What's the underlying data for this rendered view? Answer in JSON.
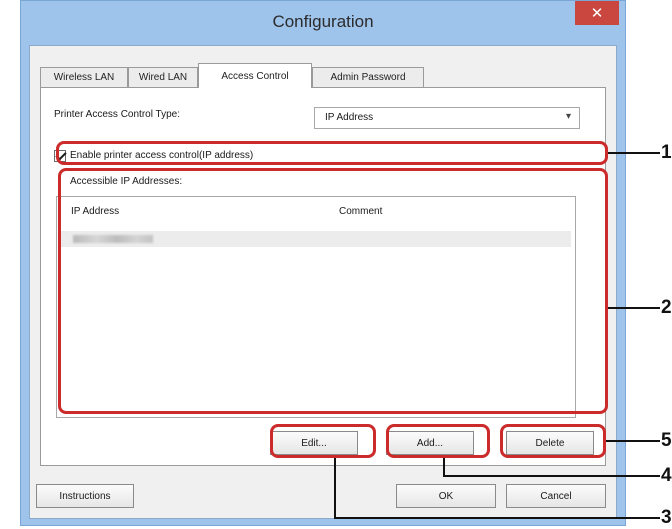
{
  "window": {
    "title": "Configuration",
    "close_glyph": "✕"
  },
  "tabs": [
    {
      "label": "Wireless LAN"
    },
    {
      "label": "Wired LAN"
    },
    {
      "label": "Access Control"
    },
    {
      "label": "Admin Password"
    }
  ],
  "access": {
    "type_label": "Printer Access Control Type:",
    "type_value": "IP Address",
    "enable_label": "Enable printer access control(IP address)",
    "enable_checked": true,
    "list_label": "Accessible IP Addresses:",
    "columns": [
      "IP Address",
      "Comment"
    ]
  },
  "buttons": {
    "edit": "Edit...",
    "add": "Add...",
    "delete": "Delete",
    "instructions": "Instructions",
    "ok": "OK",
    "cancel": "Cancel"
  },
  "callouts": [
    "1",
    "2",
    "5",
    "4",
    "3"
  ],
  "colors": {
    "callout": "#cc2b2b",
    "close": "#c9473f",
    "titlebar": "#9fc4ec"
  }
}
